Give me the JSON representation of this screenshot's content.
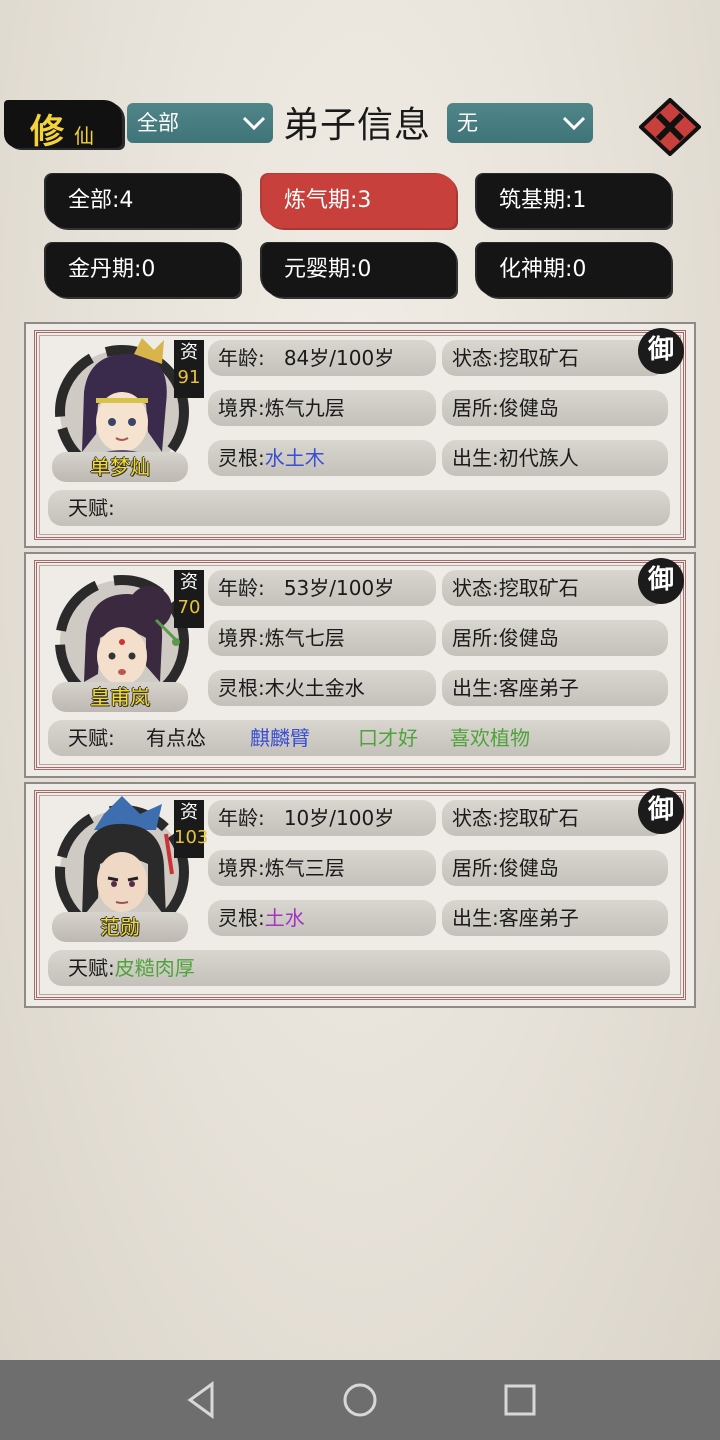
{
  "header": {
    "logo_big": "修",
    "logo_small": "仙",
    "filter_left": "全部",
    "title": "弟子信息",
    "filter_right": "无",
    "close_icon": "close-x-icon"
  },
  "tabs": [
    {
      "label": "全部:4",
      "active": false
    },
    {
      "label": "炼气期:3",
      "active": true
    },
    {
      "label": "筑基期:1",
      "active": false
    },
    {
      "label": "金丹期:0",
      "active": false
    },
    {
      "label": "元婴期:0",
      "active": false
    },
    {
      "label": "化神期:0",
      "active": false
    }
  ],
  "field_labels": {
    "age": "年龄:",
    "status": "状态:",
    "realm": "境界:",
    "home": "居所:",
    "root": "灵根:",
    "birth": "出生:",
    "talent": "天赋:",
    "aptitude": "资",
    "seal": "御"
  },
  "colors": {
    "active_tab": "#c8403b",
    "root_water_earth_wood": "#3a4fd1",
    "root_earth_water": "#a235c4",
    "talent_blue": "#3a4fd1",
    "talent_green": "#4fa33a",
    "name_yellow": "#f6dc2b",
    "aptitude_yellow": "#e8c33a"
  },
  "disciples": [
    {
      "name": "单梦灿",
      "aptitude": "91",
      "age": "84岁/100岁",
      "status": "挖取矿石",
      "realm": "炼气九层",
      "home": "俊健岛",
      "root": "水土木",
      "root_color": "#3a4fd1",
      "birth": "初代族人",
      "talents": []
    },
    {
      "name": "皇甫岚",
      "aptitude": "70",
      "age": "53岁/100岁",
      "status": "挖取矿石",
      "realm": "炼气七层",
      "home": "俊健岛",
      "root": "木火土金水",
      "root_color": "#1a1a1a",
      "birth": "客座弟子",
      "talents": [
        {
          "text": "有点怂",
          "color": "#1a1a1a"
        },
        {
          "text": "麒麟臂",
          "color": "#3a4fd1"
        },
        {
          "text": "口才好",
          "color": "#4fa33a"
        },
        {
          "text": "喜欢植物",
          "color": "#4fa33a"
        }
      ]
    },
    {
      "name": "范勋",
      "aptitude": "103",
      "age": "10岁/100岁",
      "status": "挖取矿石",
      "realm": "炼气三层",
      "home": "俊健岛",
      "root": "土水",
      "root_color": "#a235c4",
      "birth": "客座弟子",
      "talents": [
        {
          "text": "皮糙肉厚",
          "color": "#4fa33a"
        }
      ]
    }
  ],
  "navbar": {
    "back_icon": "back-triangle-icon",
    "home_icon": "home-circle-icon",
    "recents_icon": "recents-square-icon"
  }
}
